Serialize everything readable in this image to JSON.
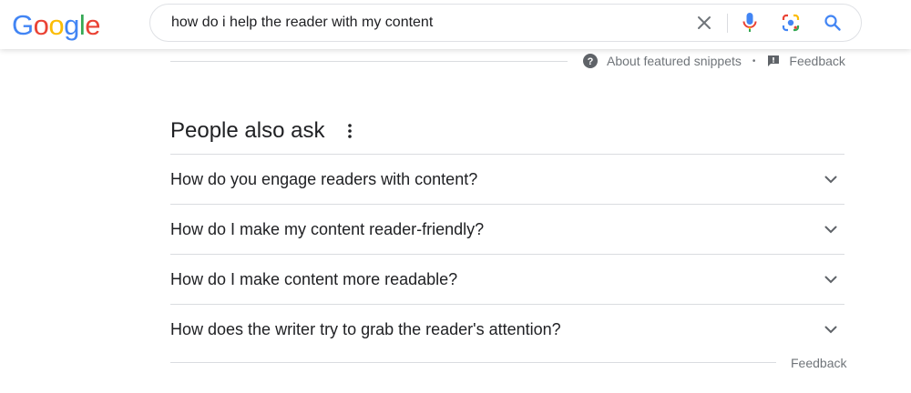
{
  "logo": {
    "letters": [
      "G",
      "o",
      "o",
      "g",
      "l",
      "e"
    ],
    "colors": [
      "#4285F4",
      "#EA4335",
      "#FBBC05",
      "#4285F4",
      "#34A853",
      "#EA4335"
    ]
  },
  "search": {
    "query": "how do i help the reader with my content",
    "icons": {
      "clear": "close-icon",
      "mic": "microphone-icon",
      "lens": "google-lens-icon",
      "search": "search-icon"
    }
  },
  "snippet_footer": {
    "about_label": "About featured snippets",
    "separator": "•",
    "feedback_label": "Feedback"
  },
  "people_also_ask": {
    "title": "People also ask",
    "questions": [
      "How do you engage readers with content?",
      "How do I make my content reader-friendly?",
      "How do I make content more readable?",
      "How does the writer try to grab the reader's attention?"
    ],
    "feedback_label": "Feedback"
  },
  "colors": {
    "text_primary": "#202124",
    "text_secondary": "#70757a",
    "divider": "#dadce0",
    "blue": "#4285F4",
    "red": "#EA4335",
    "yellow": "#FBBC05",
    "green": "#34A853"
  }
}
